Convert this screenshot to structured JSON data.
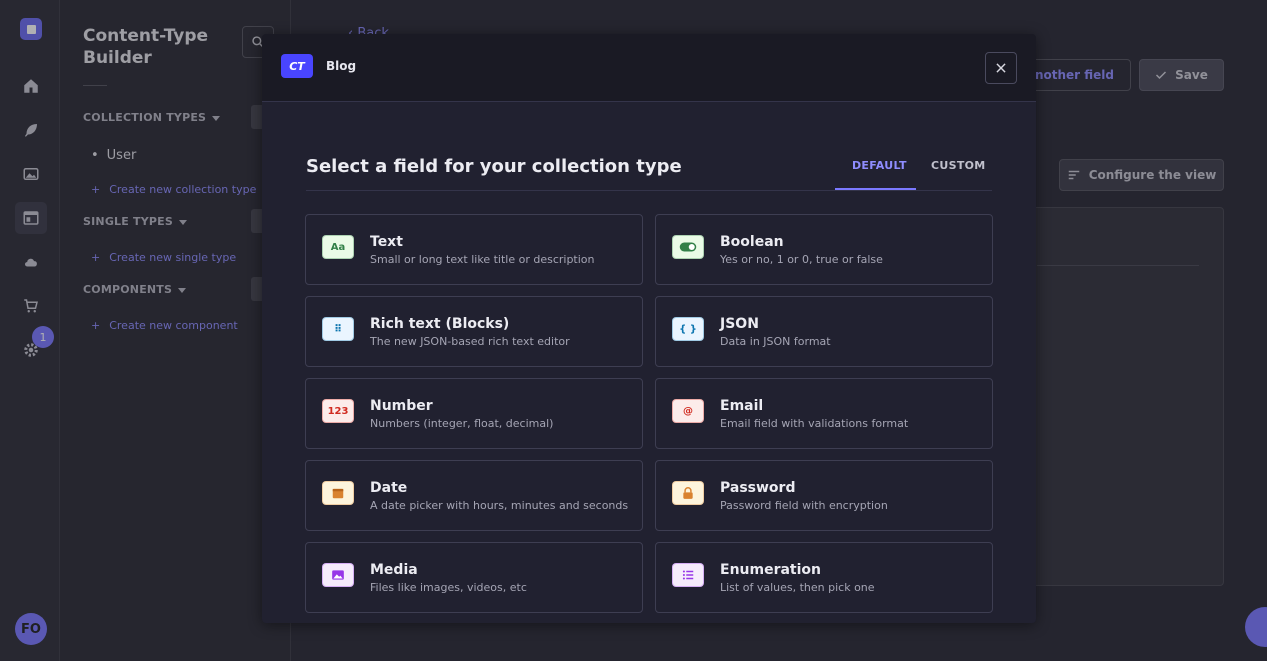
{
  "sidebar": {
    "title": "Content-Type Builder",
    "sections": [
      {
        "label": "COLLECTION TYPES",
        "items": [
          "User"
        ],
        "create": "Create new collection type"
      },
      {
        "label": "SINGLE TYPES",
        "items": [],
        "create": "Create new single type"
      },
      {
        "label": "COMPONENTS",
        "items": [],
        "create": "Create new component"
      }
    ]
  },
  "rail": {
    "notification_count": "1",
    "avatar_initials": "FO"
  },
  "main": {
    "back_label": "Back",
    "add_field_label": "another field",
    "save_label": "Save",
    "configure_label": "Configure the view"
  },
  "modal": {
    "badge": "CT",
    "type_name": "Blog",
    "title": "Select a field for your collection type",
    "tabs": [
      {
        "label": "DEFAULT",
        "active": true
      },
      {
        "label": "CUSTOM",
        "active": false
      }
    ],
    "fields": [
      {
        "name": "Text",
        "desc": "Small or long text like title or description",
        "icon": "text-icon",
        "glyph": "Aa",
        "color": "#328048",
        "bg": "#eafbe7"
      },
      {
        "name": "Boolean",
        "desc": "Yes or no, 1 or 0, true or false",
        "icon": "toggle-icon",
        "glyph": "",
        "color": "#328048",
        "bg": "#eafbe7"
      },
      {
        "name": "Rich text (Blocks)",
        "desc": "The new JSON-based rich text editor",
        "icon": "blocks-icon",
        "glyph": "⠿",
        "color": "#0c75af",
        "bg": "#eaf5ff"
      },
      {
        "name": "JSON",
        "desc": "Data in JSON format",
        "icon": "json-icon",
        "glyph": "{ }",
        "color": "#0c75af",
        "bg": "#eaf5ff"
      },
      {
        "name": "Number",
        "desc": "Numbers (integer, float, decimal)",
        "icon": "number-icon",
        "glyph": "123",
        "color": "#d02b20",
        "bg": "#fcecea"
      },
      {
        "name": "Email",
        "desc": "Email field with validations format",
        "icon": "email-icon",
        "glyph": "@",
        "color": "#d02b20",
        "bg": "#fcecea"
      },
      {
        "name": "Date",
        "desc": "A date picker with hours, minutes and seconds",
        "icon": "calendar-icon",
        "glyph": "",
        "color": "#d9822f",
        "bg": "#fdf4dc"
      },
      {
        "name": "Password",
        "desc": "Password field with encryption",
        "icon": "lock-icon",
        "glyph": "",
        "color": "#d9822f",
        "bg": "#fdf4dc"
      },
      {
        "name": "Media",
        "desc": "Files like images, videos, etc",
        "icon": "image-icon",
        "glyph": "",
        "color": "#9736e8",
        "bg": "#f6ecfc"
      },
      {
        "name": "Enumeration",
        "desc": "List of values, then pick one",
        "icon": "list-icon",
        "glyph": "",
        "color": "#9736e8",
        "bg": "#f6ecfc"
      }
    ]
  }
}
